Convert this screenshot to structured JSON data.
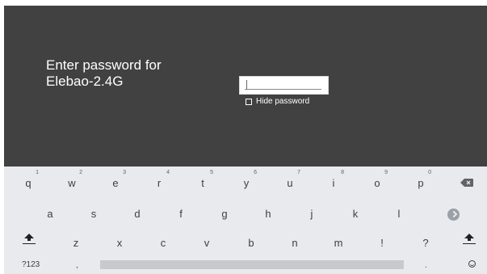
{
  "dialog": {
    "prompt_line1": "Enter password for",
    "prompt_line2": "Elebao-2.4G",
    "password_value": "",
    "hide_password_label": "Hide password",
    "hide_password_checked": false
  },
  "keyboard": {
    "row1": [
      {
        "key": "q",
        "hint": "1"
      },
      {
        "key": "w",
        "hint": "2"
      },
      {
        "key": "e",
        "hint": "3"
      },
      {
        "key": "r",
        "hint": "4"
      },
      {
        "key": "t",
        "hint": "5"
      },
      {
        "key": "y",
        "hint": "6"
      },
      {
        "key": "u",
        "hint": "7"
      },
      {
        "key": "i",
        "hint": "8"
      },
      {
        "key": "o",
        "hint": "9"
      },
      {
        "key": "p",
        "hint": "0"
      }
    ],
    "row2": [
      "a",
      "s",
      "d",
      "f",
      "g",
      "h",
      "j",
      "k",
      "l"
    ],
    "row3": [
      "z",
      "x",
      "c",
      "v",
      "b",
      "n",
      "m",
      "!",
      "?"
    ],
    "symbols_label": "?123",
    "comma_label": ",",
    "period_label": ".",
    "icons": {
      "backspace": "backspace-icon",
      "enter": "enter-icon",
      "shift": "shift-icon",
      "emoji": "emoji-icon"
    }
  }
}
